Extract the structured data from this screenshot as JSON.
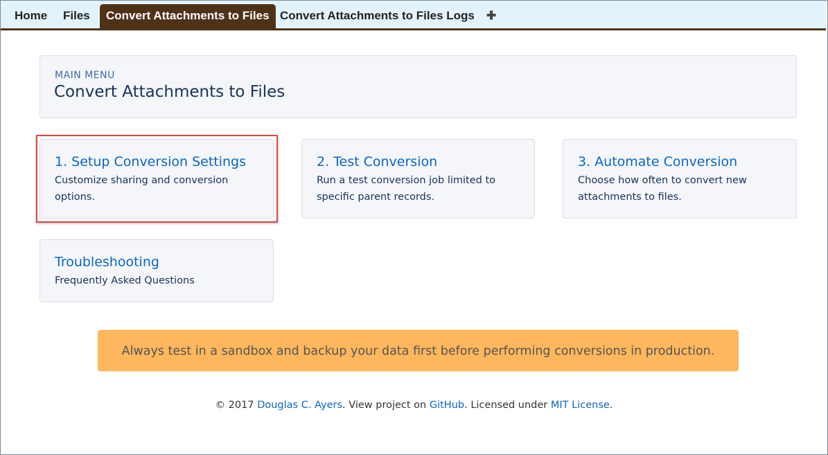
{
  "tabs": [
    {
      "label": "Home"
    },
    {
      "label": "Files"
    },
    {
      "label": "Convert Attachments to Files",
      "active": true
    },
    {
      "label": "Convert Attachments to Files Logs"
    }
  ],
  "add_tab_icon": "plus-icon",
  "add_tab_glyph": "✚",
  "header": {
    "eyebrow": "MAIN MENU",
    "title": "Convert Attachments to Files"
  },
  "tiles": [
    {
      "title": "1. Setup Conversion Settings",
      "description": "Customize sharing and conversion options."
    },
    {
      "title": "2. Test Conversion",
      "description": "Run a test conversion job limited to specific parent records."
    },
    {
      "title": "3. Automate Conversion",
      "description": "Choose how often to convert new attachments to files."
    },
    {
      "title": "Troubleshooting",
      "description": "Frequently Asked Questions"
    }
  ],
  "warning": "Always test in a sandbox and backup your data first before performing conversions in production.",
  "footer": {
    "copyright": "© 2017 ",
    "author": "Douglas C. Ayers",
    "text_1": ". View project on ",
    "github": "GitHub",
    "text_2": ". Licensed under ",
    "license": "MIT License",
    "text_3": "."
  },
  "colors": {
    "tab_active_bg": "#4e3218",
    "tabbar_bg": "#e3f3fb",
    "link": "#0a66c2",
    "warning_bg": "#ffb75d",
    "highlight_border": "#e04848"
  }
}
